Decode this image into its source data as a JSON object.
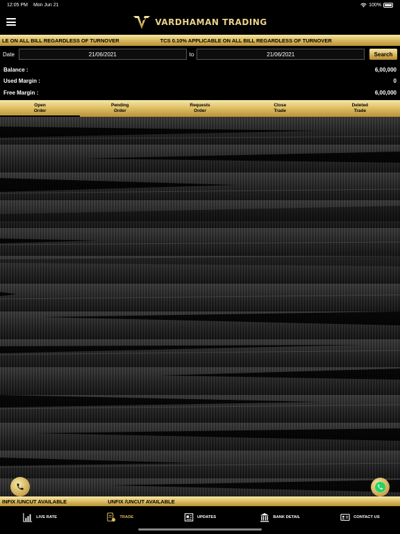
{
  "status_bar": {
    "time": "12:05 PM",
    "date": "Mon Jun 21",
    "battery": "100%"
  },
  "header": {
    "brand": "VARDHAMAN TRADING",
    "menu_icon": "hamburger-menu-icon"
  },
  "ticker_top": [
    "LE ON ALL BILL REGARDLESS OF TURNOVER",
    "TCS 0.10% APPLICABLE ON ALL BILL REGARDLESS OF TURNOVER"
  ],
  "date_filter": {
    "label": "Date",
    "from": "21/06/2021",
    "to_label": "to",
    "to": "21/06/2021",
    "search_label": "Search"
  },
  "balances": [
    {
      "label": "Balance :",
      "value": "6,00,000"
    },
    {
      "label": "Used Margin :",
      "value": "0"
    },
    {
      "label": "Free Margin :",
      "value": "6,00,000"
    }
  ],
  "tabs": [
    {
      "line1": "Open",
      "line2": "Order",
      "active": true
    },
    {
      "line1": "Pending",
      "line2": "Order",
      "active": false
    },
    {
      "line1": "Requests",
      "line2": "Order",
      "active": false
    },
    {
      "line1": "Close",
      "line2": "Trade",
      "active": false
    },
    {
      "line1": "Deleted",
      "line2": "Trade",
      "active": false
    }
  ],
  "ticker_bottom": [
    "INFIX /UNCUT AVAILABLE",
    "UNFIX /UNCUT AVAILABLE"
  ],
  "nav": [
    {
      "label": "LIVE RATE",
      "icon": "chart-icon",
      "active": false
    },
    {
      "label": "TRADE",
      "icon": "trade-icon",
      "active": true
    },
    {
      "label": "UPDATES",
      "icon": "newspaper-icon",
      "active": false
    },
    {
      "label": "BANK DETAIL",
      "icon": "bank-icon",
      "active": false
    },
    {
      "label": "CONTACT US",
      "icon": "contact-card-icon",
      "active": false
    }
  ],
  "colors": {
    "gold_light": "#f6e8a8",
    "gold": "#d9b85c",
    "gold_dark": "#b99238",
    "background": "#000000"
  }
}
